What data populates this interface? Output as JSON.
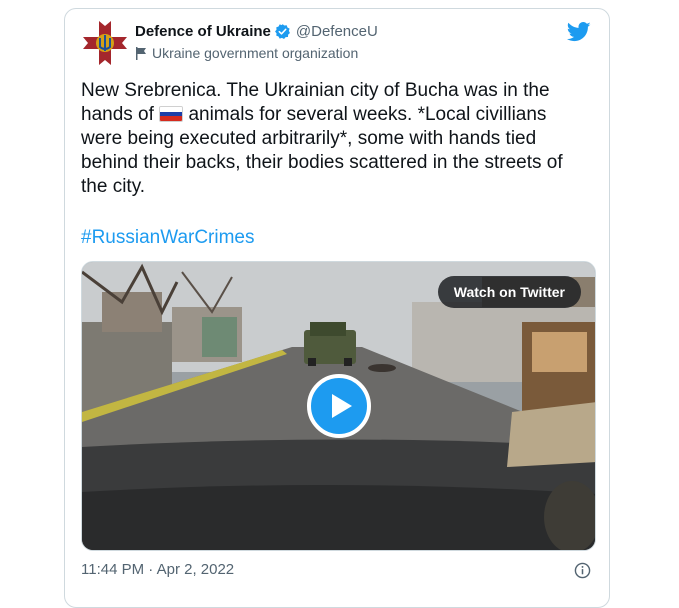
{
  "tweet": {
    "display_name": "Defence of Ukraine",
    "handle": "@DefenceU",
    "org_label": "Ukraine government organization",
    "text_before_flag": "New Srebrenica. The Ukrainian city of Bucha was in the hands of ",
    "flag_emoji": "russia-flag",
    "text_after_flag": " animals for several weeks. *Local civillians were being executed arbitrarily*, some with hands tied behind their backs, their bodies scattered in the streets of the city.",
    "hashtag": "#RussianWarCrimes",
    "timestamp": "11:44 PM · Apr 2, 2022"
  },
  "media": {
    "watch_label": "Watch on Twitter"
  },
  "icons": {
    "avatar": "ukraine-defence-emblem",
    "verified": "verified-badge-icon",
    "org_flag": "flag-icon",
    "brand": "twitter-bird-icon",
    "play": "play-icon",
    "info": "info-icon"
  },
  "colors": {
    "accent": "#1d9bf0",
    "text": "#0f1419",
    "muted": "#536471",
    "border": "#cfd9de",
    "emblem_red": "#a4262c",
    "emblem_gold": "#d4a017"
  }
}
